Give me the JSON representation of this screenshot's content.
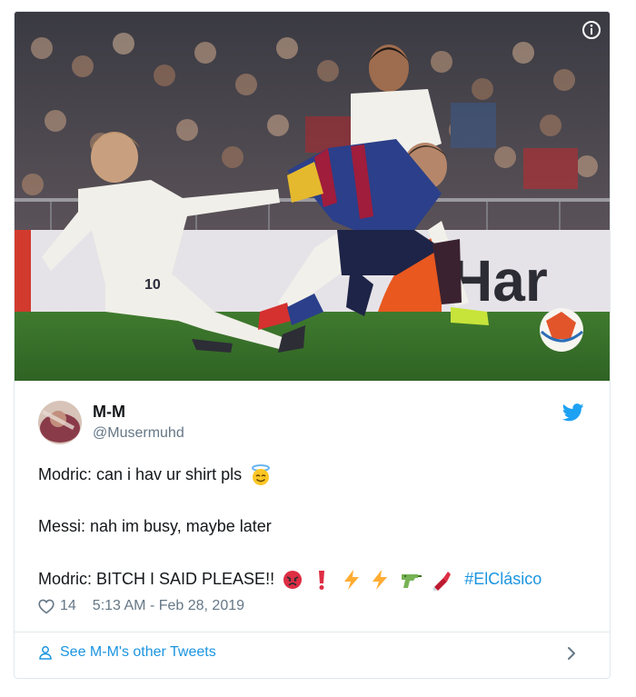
{
  "photo": {
    "icons": {
      "info": "info-icon"
    }
  },
  "tweet": {
    "display_name": "M-M",
    "handle": "@Musermuhd",
    "lines": [
      "Modric: can i hav ur shirt pls",
      "Messi: nah im busy, maybe later",
      "Modric: BITCH I SAID PLEASE!!"
    ],
    "hashtag": "#ElClásico",
    "likes": "14",
    "timestamp": "5:13 AM - Feb 28, 2019",
    "icons": {
      "brand": "twitter-bird-icon",
      "like": "heart-icon",
      "person": "person-icon",
      "chevron": "chevron-right-icon"
    },
    "emojis": [
      "smiling-face-with-halo",
      "pouting-face",
      "exclamation-mark",
      "lightning",
      "lightning",
      "water-pistol",
      "lipstick"
    ]
  },
  "footer": {
    "link_label": "See M-M's other Tweets"
  },
  "colors": {
    "link": "#1b95e0",
    "secondary_text": "#657786",
    "border": "#e1e8ed",
    "text": "#14171a"
  }
}
